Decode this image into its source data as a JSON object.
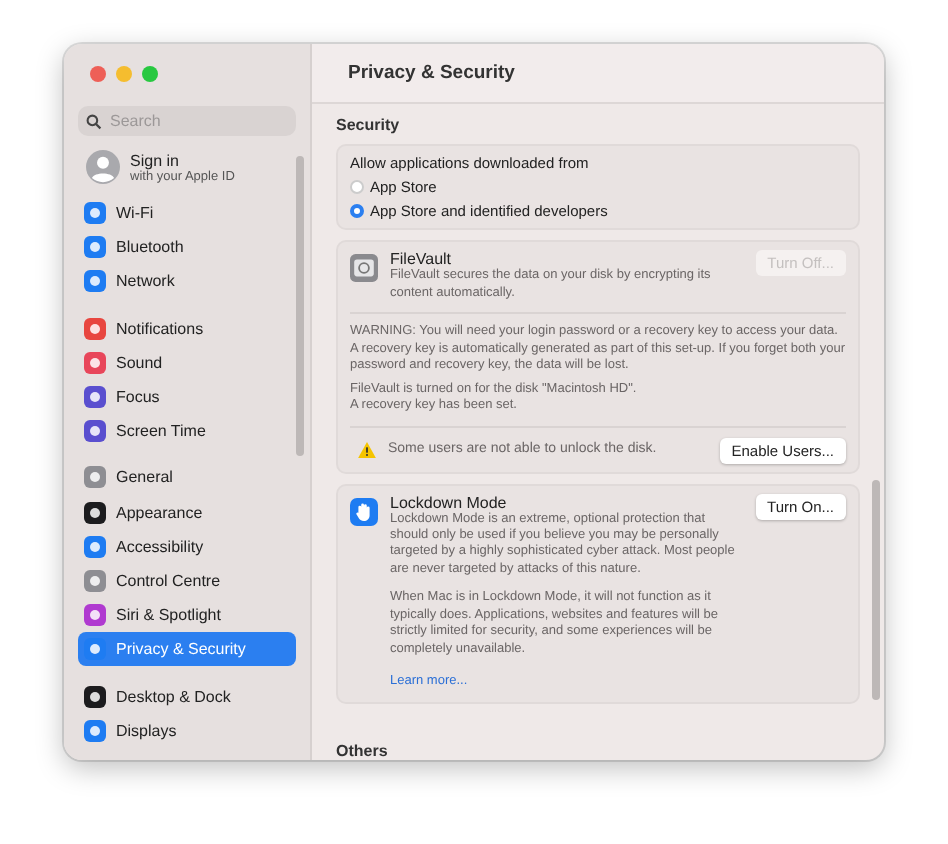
{
  "window": {
    "title": "Privacy & Security"
  },
  "sidebar": {
    "search": {
      "placeholder": "Search"
    },
    "account": {
      "title": "Sign in",
      "subtitle": "with your Apple ID"
    },
    "groups": [
      {
        "items": [
          {
            "label": "Wi-Fi",
            "color": "#1e7cf2",
            "selected": false
          },
          {
            "label": "Bluetooth",
            "color": "#1e7cf2",
            "selected": false
          },
          {
            "label": "Network",
            "color": "#1e7cf2",
            "selected": false
          }
        ]
      },
      {
        "items": [
          {
            "label": "Notifications",
            "color": "#e8463f",
            "selected": false
          },
          {
            "label": "Sound",
            "color": "#e8465a",
            "selected": false
          },
          {
            "label": "Focus",
            "color": "#5a4fcf",
            "selected": false
          },
          {
            "label": "Screen Time",
            "color": "#5a4fcf",
            "selected": false
          }
        ]
      },
      {
        "items": [
          {
            "label": "General",
            "color": "#8e8e93",
            "selected": false
          },
          {
            "label": "Appearance",
            "color": "#1c1c1e",
            "selected": false
          },
          {
            "label": "Accessibility",
            "color": "#1e7cf2",
            "selected": false
          },
          {
            "label": "Control Centre",
            "color": "#8e8e93",
            "selected": false
          },
          {
            "label": "Siri & Spotlight",
            "color": "#b03ad0",
            "selected": false
          },
          {
            "label": "Privacy & Security",
            "color": "#1e7cf2",
            "selected": true
          }
        ]
      },
      {
        "items": [
          {
            "label": "Desktop & Dock",
            "color": "#1c1c1e",
            "selected": false
          },
          {
            "label": "Displays",
            "color": "#1e7cf2",
            "selected": false
          }
        ]
      }
    ]
  },
  "security": {
    "heading": "Security",
    "allow": {
      "label": "Allow applications downloaded from",
      "options": [
        {
          "label": "App Store",
          "selected": false
        },
        {
          "label": "App Store and identified developers",
          "selected": true
        }
      ]
    },
    "filevault": {
      "title": "FileVault",
      "description": "FileVault secures the data on your disk by encrypting its content automatically.",
      "button": {
        "label": "Turn Off...",
        "disabled": true
      },
      "warning": "WARNING: You will need your login password or a recovery key to access your data. A recovery key is automatically generated as part of this set-up. If you forget both your password and recovery key, the data will be lost.",
      "status": [
        "FileVault is turned on for the disk \"Macintosh HD\".",
        "A recovery key has been set."
      ],
      "alert": "Some users are not able to unlock the disk.",
      "alert_button": {
        "label": "Enable Users...",
        "disabled": false
      }
    },
    "lockdown": {
      "title": "Lockdown Mode",
      "description": "Lockdown Mode is an extreme, optional protection that should only be used if you believe you may be personally targeted by a highly sophisticated cyber attack. Most people are never targeted by attacks of this nature.",
      "details": "When Mac is in Lockdown Mode, it will not function as it typically does. Applications, websites and features will be strictly limited for security, and some experiences will be completely unavailable.",
      "link": "Learn more...",
      "button": {
        "label": "Turn On...",
        "disabled": false
      }
    }
  },
  "others": {
    "heading": "Others"
  }
}
